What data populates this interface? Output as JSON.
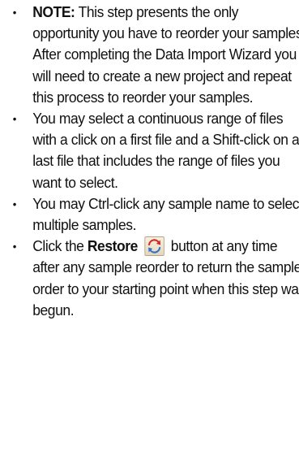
{
  "items": [
    {
      "bold": "NOTE:",
      "text": " This step presents the only opportunity you have to reorder your samples. After completing the Data Import Wizard you will need to create a new project and repeat this process to reorder your samples."
    },
    {
      "text": "You may select a continuous range of files with a click on a first file and a Shift-click on a last file that includes the range of files you want to select."
    },
    {
      "text": "You may Ctrl-click any sample name to select multiple samples."
    },
    {
      "prefix": "Click the ",
      "bold": "Restore",
      "icon": "restore-icon",
      "suffix": " button at any time after any sample reorder to return the sample order to your starting point when this step was begun."
    }
  ],
  "bullet_glyph": "•",
  "colors": {
    "icon_red": "#d62a1e",
    "icon_blue": "#2f74c9",
    "icon_bg": "#efe3cd"
  }
}
